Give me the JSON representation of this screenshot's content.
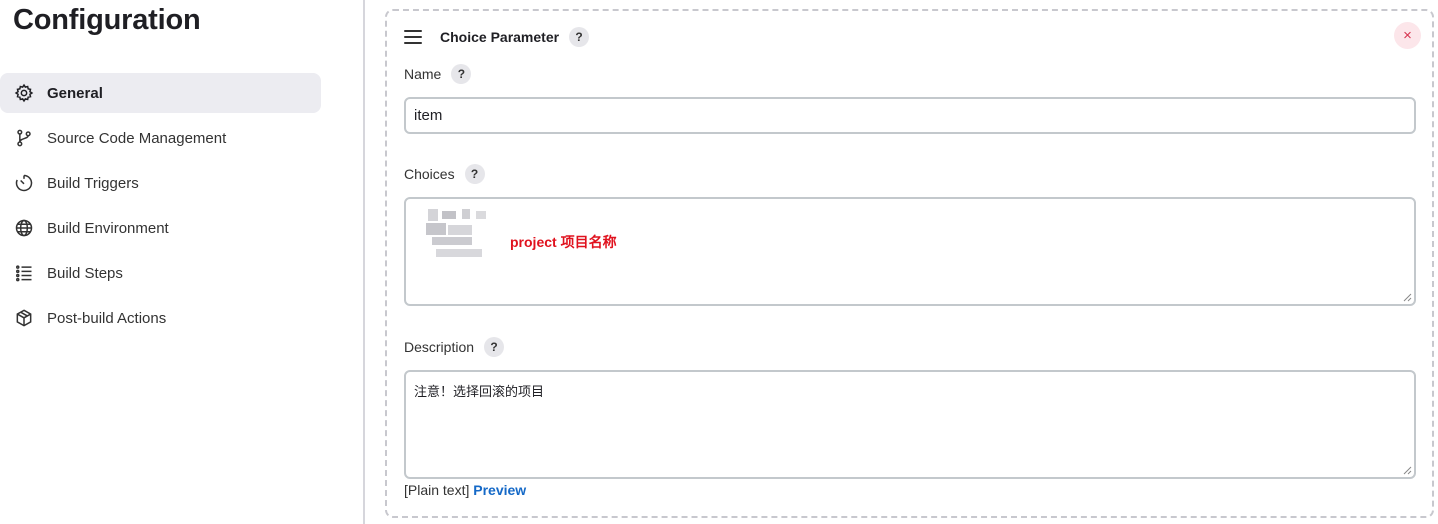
{
  "page_title": "Configuration",
  "sidebar": {
    "items": [
      {
        "label": "General",
        "icon": "gear-icon",
        "active": true
      },
      {
        "label": "Source Code Management",
        "icon": "branch-icon"
      },
      {
        "label": "Build Triggers",
        "icon": "timer-icon"
      },
      {
        "label": "Build Environment",
        "icon": "globe-icon"
      },
      {
        "label": "Build Steps",
        "icon": "list-icon"
      },
      {
        "label": "Post-build Actions",
        "icon": "package-icon"
      }
    ]
  },
  "parameter": {
    "title": "Choice Parameter",
    "help": "?",
    "close": "×",
    "name": {
      "label": "Name",
      "value": "item"
    },
    "choices": {
      "label": "Choices",
      "annotation": "project 项目名称"
    },
    "description": {
      "label": "Description",
      "value": "注意！选择回滚的项目"
    },
    "format_text": "[Plain text]",
    "preview_label": "Preview"
  },
  "colors": {
    "accent_link": "#1569c7",
    "annotation_red": "#e0121e",
    "close_red": "#d6334f",
    "active_nav_bg": "#ececf1"
  }
}
